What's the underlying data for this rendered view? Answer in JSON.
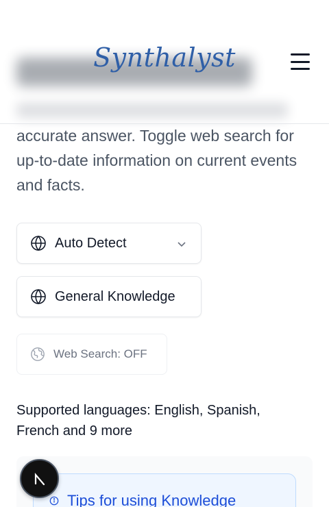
{
  "header": {
    "logo_text": "Synthalyst",
    "menu_icon": "hamburger-menu-icon"
  },
  "content": {
    "description": "accurate answer. Toggle web search for up-to-date information on current events and facts.",
    "language_select": {
      "value": "Auto Detect",
      "icon": "globe-icon"
    },
    "domain_select": {
      "value": "General Knowledge",
      "icon": "globe-icon"
    },
    "web_search_toggle": {
      "label": "Web Search: OFF",
      "icon": "globe-off-icon"
    },
    "supported_languages": "Supported languages: English, Spanish, French and 9 more",
    "tips": {
      "title": "Tips for using Knowledge",
      "icon": "info-icon"
    }
  },
  "fab": {
    "icon": "next-logo-icon"
  },
  "colors": {
    "logo": "#2f5fa7",
    "tips_text": "#1d4ed8",
    "tips_bg": "#eff6ff"
  }
}
